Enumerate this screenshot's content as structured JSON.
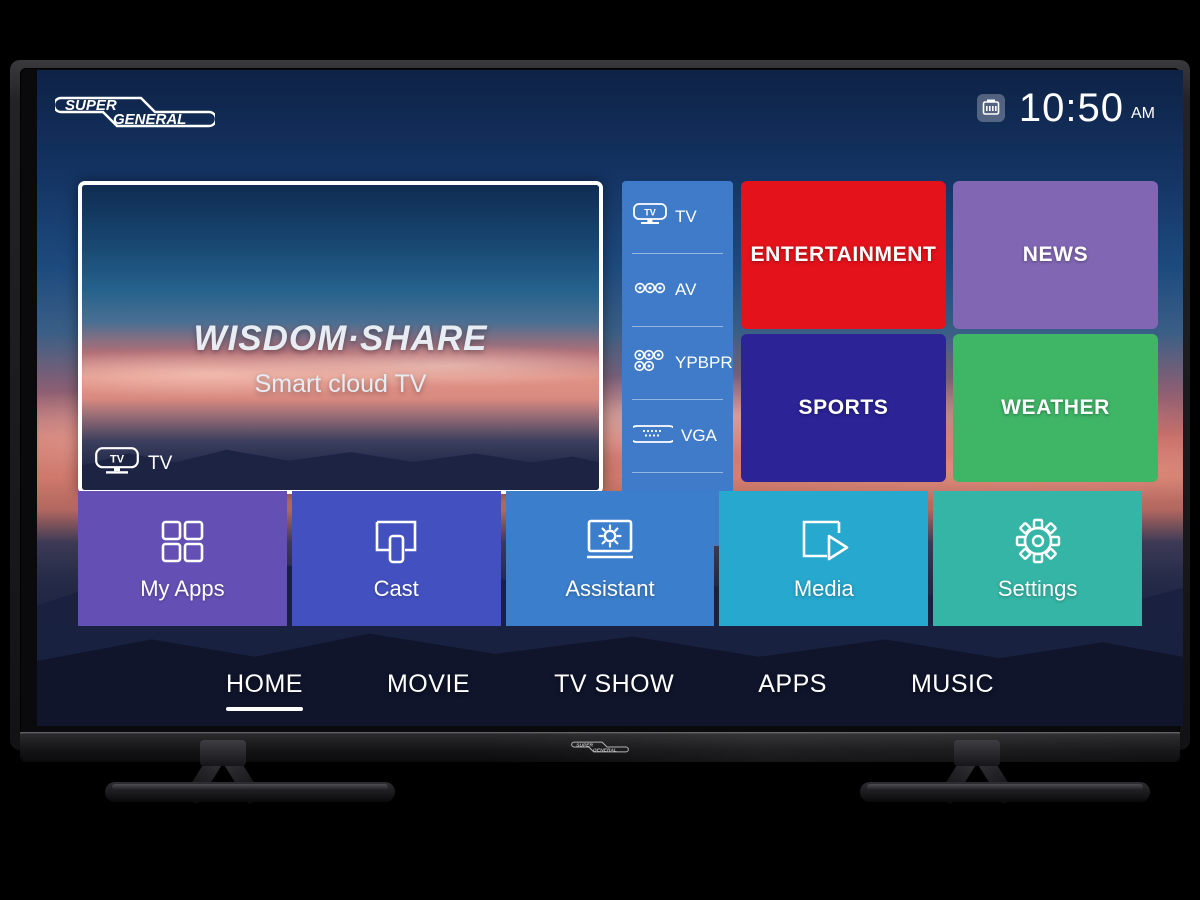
{
  "device": {
    "brand_logo_top": "SUPER GENERAL",
    "brand_logo_bezel": "SUPER GENERAL",
    "logo_word1": "SUPER",
    "logo_word2": "GENERAL"
  },
  "header": {
    "network_icon": "ethernet-icon",
    "time": "10:50",
    "ampm": "AM"
  },
  "preview": {
    "title": "WISDOM·SHARE",
    "subtitle": "Smart cloud TV",
    "badge_icon": "tv-icon",
    "badge_label": "TV"
  },
  "sources": {
    "items": [
      {
        "label": "TV",
        "icon": "tv-icon"
      },
      {
        "label": "AV",
        "icon": "rca-av-icon"
      },
      {
        "label": "YPBPR",
        "icon": "component-ypbpr-icon"
      },
      {
        "label": "VGA",
        "icon": "vga-connector-icon"
      }
    ]
  },
  "categories": [
    {
      "label": "ENTERTAINMENT",
      "color": "#E3121B"
    },
    {
      "label": "NEWS",
      "color": "#8166B4"
    },
    {
      "label": "SPORTS",
      "color": "#2B2396"
    },
    {
      "label": "WEATHER",
      "color": "#3FB566"
    }
  ],
  "apps": [
    {
      "label": "My Apps",
      "icon": "grid-apps-icon",
      "color": "#6450B4"
    },
    {
      "label": "Cast",
      "icon": "cast-screen-icon",
      "color": "#4351C0"
    },
    {
      "label": "Assistant",
      "icon": "assistant-sun-icon",
      "color": "#3B7ECC"
    },
    {
      "label": "Media",
      "icon": "media-play-icon",
      "color": "#27A8CE"
    },
    {
      "label": "Settings",
      "icon": "gear-icon",
      "color": "#35B5A5"
    }
  ],
  "nav": {
    "items": [
      {
        "label": "HOME",
        "active": true
      },
      {
        "label": "MOVIE",
        "active": false
      },
      {
        "label": "TV SHOW",
        "active": false
      },
      {
        "label": "APPS",
        "active": false
      },
      {
        "label": "MUSIC",
        "active": false
      }
    ]
  },
  "colors": {
    "source_panel": "#3F7BC8",
    "screen_bg_top": "#0E2246",
    "accent_white": "#FFFFFF"
  }
}
